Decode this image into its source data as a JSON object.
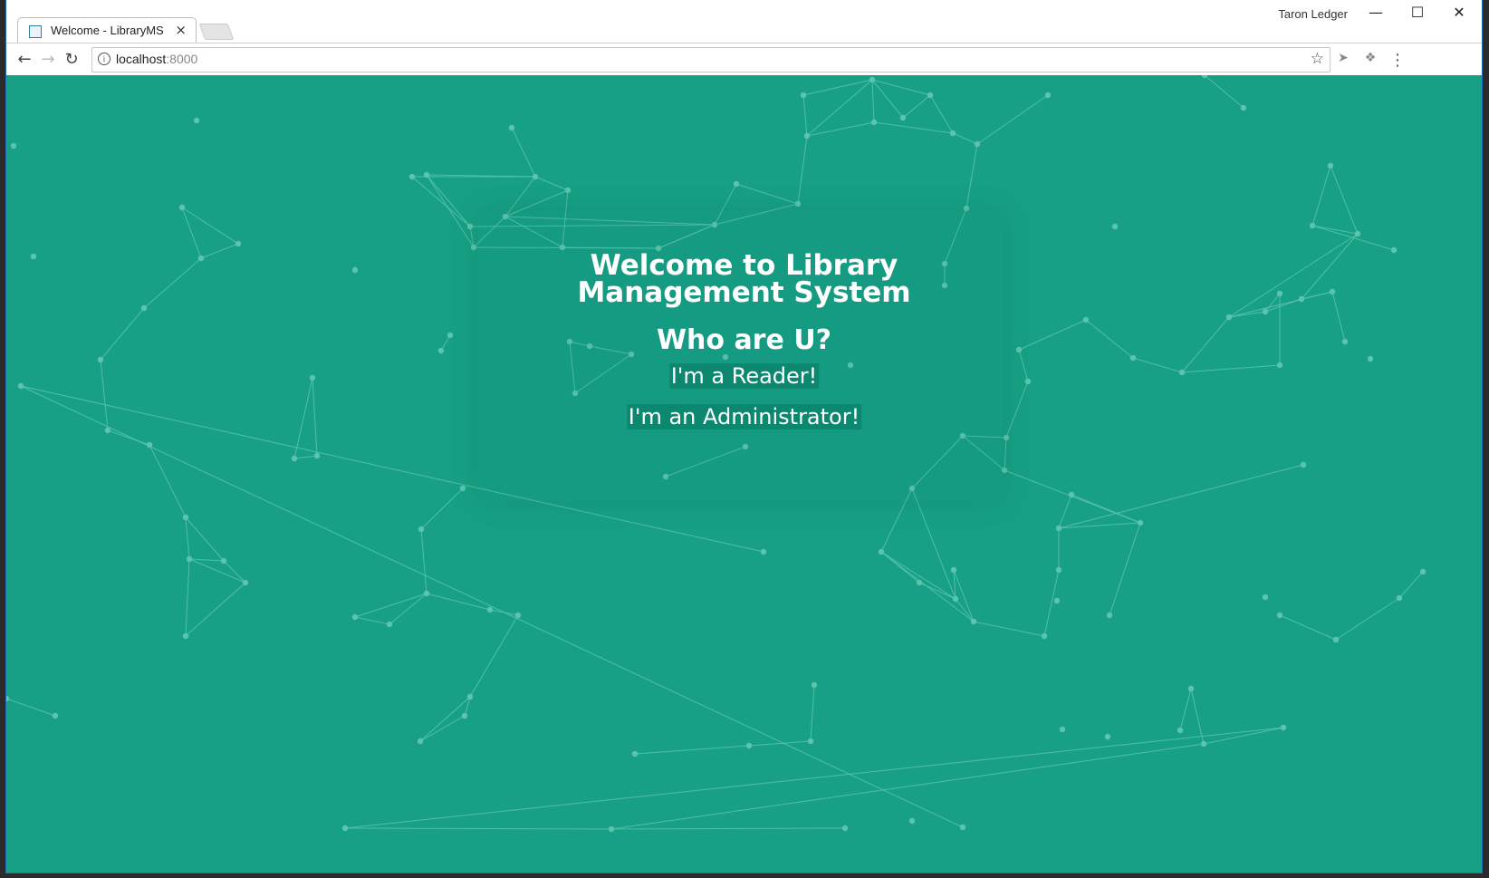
{
  "browser": {
    "tab_title": "Welcome - LibraryMS",
    "tab_close": "×",
    "profile_name": "Taron Ledger",
    "url_host": "localhost",
    "url_port": ":8000",
    "info_glyph": "i",
    "star_glyph": "☆",
    "back_glyph": "←",
    "forward_glyph": "→",
    "reload_glyph": "↻",
    "minimize_glyph": "—",
    "maximize_glyph": "☐",
    "close_glyph": "✕",
    "menu_glyph": "⋮",
    "ext_one_glyph": "➤",
    "ext_two_glyph": "❖"
  },
  "page": {
    "title_line1": "Welcome to Library",
    "title_line2": "Management System",
    "question": "Who are U?",
    "reader_button": "I'm a Reader!",
    "admin_button": "I'm an Administrator!"
  },
  "theme": {
    "background": "#17a085",
    "node_color": "#5cc4ad"
  }
}
